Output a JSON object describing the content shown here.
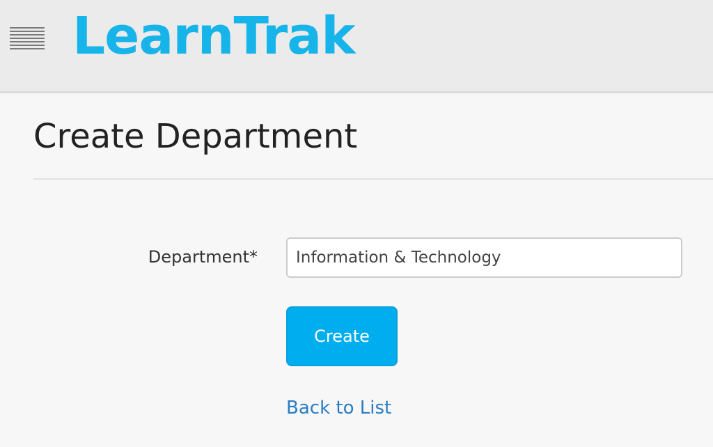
{
  "header": {
    "menu_icon": "hamburger-menu-icon",
    "logo_text": "LearnTrak",
    "logo_color": "#17b4ea"
  },
  "page": {
    "title": "Create Department"
  },
  "form": {
    "department_label": "Department*",
    "department_value": "Information & Technology",
    "create_label": "Create",
    "button_color": "#00adef"
  },
  "footer_links": {
    "back_label": "Back to List",
    "link_color": "#2a7dc4"
  }
}
